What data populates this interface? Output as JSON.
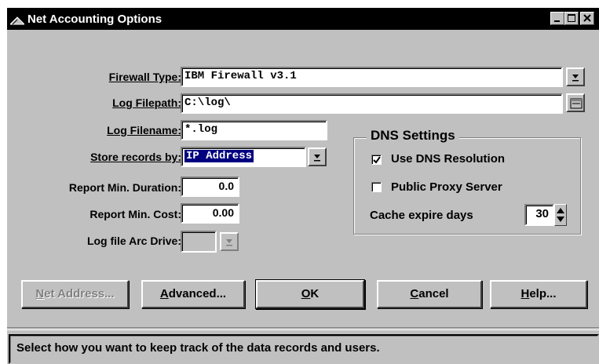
{
  "window": {
    "title": "Net Accounting Options"
  },
  "form": {
    "firewall_type": {
      "label": "Firewall Type:",
      "value": "IBM Firewall v3.1"
    },
    "log_filepath": {
      "label": "Log Filepath:",
      "value": "C:\\log\\"
    },
    "log_filename": {
      "label": "Log Filename:",
      "value": "*.log"
    },
    "store_records_by": {
      "label": "Store records by:",
      "value": "IP Address"
    },
    "report_min_duration": {
      "label": "Report Min. Duration:",
      "value": "0.0"
    },
    "report_min_cost": {
      "label": "Report Min. Cost:",
      "value": "0.00"
    },
    "log_file_arc_drive": {
      "label": "Log file Arc Drive:",
      "value": ""
    }
  },
  "dns": {
    "title": "DNS Settings",
    "use_dns_resolution": {
      "label": "Use DNS Resolution",
      "checked": true
    },
    "public_proxy_server": {
      "label": "Public Proxy Server",
      "checked": false
    },
    "cache_expire_days": {
      "label": "Cache expire days",
      "value": "30"
    }
  },
  "buttons": {
    "net_address": {
      "mnemonic": "N",
      "rest": "et Address...",
      "enabled": false
    },
    "advanced": {
      "mnemonic": "A",
      "rest": "dvanced..."
    },
    "ok": {
      "mnemonic": "O",
      "rest": "K",
      "default": true
    },
    "cancel": {
      "mnemonic": "C",
      "rest": "ancel"
    },
    "help": {
      "mnemonic": "H",
      "rest": "elp..."
    }
  },
  "status_bar": {
    "text": "Select how you want to keep track of the data records and users."
  },
  "icons": [
    "window-icon",
    "minimize-icon",
    "maximize-icon",
    "close-icon",
    "dropdown-arrow-icon",
    "folder-browse-icon",
    "checkmark-icon",
    "spin-up-icon",
    "spin-down-icon"
  ],
  "colors": {
    "titlebar": "#000000",
    "face": "#c0c0c0",
    "selection": "#000080"
  }
}
